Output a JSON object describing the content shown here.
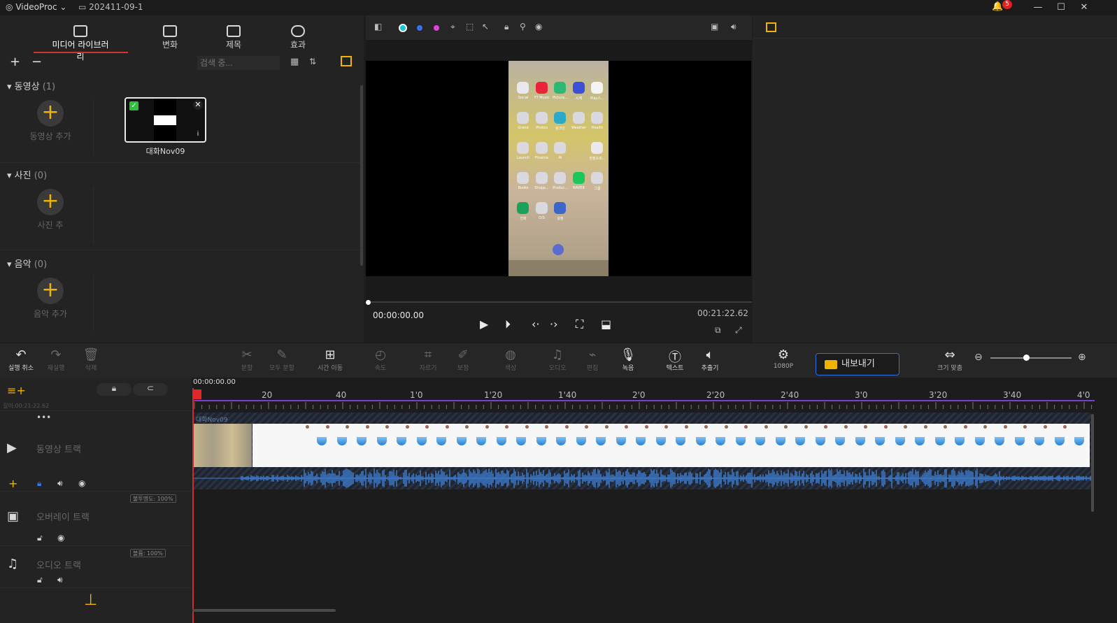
{
  "titlebar": {
    "app_name": "VideoProc",
    "project_name": "202411-09-1",
    "notification_count": "5",
    "minimize": "—",
    "maximize": "☐",
    "close": "✕"
  },
  "left_tabs": [
    {
      "label": "미디어 라이브러리",
      "icon": "media-library-icon"
    },
    {
      "label": "변화",
      "icon": "transition-icon"
    },
    {
      "label": "제목",
      "icon": "title-icon"
    },
    {
      "label": "효과",
      "icon": "effect-icon"
    }
  ],
  "library": {
    "search_placeholder": "검색 중...",
    "add": "+",
    "remove": "−",
    "sections": {
      "video": {
        "name": "동영상",
        "count": "(1)",
        "add_label": "동영상 추가"
      },
      "photo": {
        "name": "사진",
        "count": "(0)",
        "add_label": "사진 추"
      },
      "music": {
        "name": "음악",
        "count": "(0)",
        "add_label": "음악 추가"
      }
    },
    "clip_name": "대화Nov09"
  },
  "preview": {
    "current_time": "00:00:00.00",
    "total_time": "00:21:22.62",
    "phone_apps": [
      {
        "label": "Social",
        "color": "#e8e8ee"
      },
      {
        "label": "YT Music",
        "color": "#e8233a"
      },
      {
        "label": "Picture...",
        "color": "#2eb875"
      },
      {
        "label": "시계",
        "color": "#3a50d6"
      },
      {
        "label": "Play스...",
        "color": "#f4f4f4"
      },
      {
        "label": "Grand",
        "color": "#d9d9df"
      },
      {
        "label": "Photos",
        "color": "#d9d9df"
      },
      {
        "label": "링크인",
        "color": "#2aa9c9"
      },
      {
        "label": "Weather",
        "color": "#d9d9df"
      },
      {
        "label": "Health",
        "color": "#d9d9df"
      },
      {
        "label": "Launch",
        "color": "#d9d9df"
      },
      {
        "label": "Finance",
        "color": "#d9d9df"
      },
      {
        "label": "AI",
        "color": "#d9d9df"
      },
      {
        "label": "",
        "color": "transparent"
      },
      {
        "label": "한컴오피...",
        "color": "#e8e8ee"
      },
      {
        "label": "Books",
        "color": "#d9d9df"
      },
      {
        "label": "Shopp...",
        "color": "#d9d9df"
      },
      {
        "label": "Produc...",
        "color": "#d9d9df"
      },
      {
        "label": "NAVER",
        "color": "#19c75a"
      },
      {
        "label": "그룹",
        "color": "#d9d9df"
      },
      {
        "label": "전화",
        "color": "#1aa15a"
      },
      {
        "label": "O/S",
        "color": "#d9d9df"
      },
      {
        "label": "설정",
        "color": "#3d66c9"
      }
    ]
  },
  "toolbar": {
    "undo": "실행 취소",
    "redo": "재실행",
    "delete": "삭제",
    "split": "분할",
    "split_all": "모두 분할",
    "time_move": "시간 이동",
    "speed": "속도",
    "crop": "자르기",
    "correct": "보정",
    "color": "색상",
    "audio": "오디오",
    "edit": "편집",
    "record": "녹음",
    "text": "텍스트",
    "extract": "추출기",
    "resolution": "1080P",
    "export": "내보내기",
    "fit": "크기 맞춤"
  },
  "timeline": {
    "start_time": "00:00:00.00",
    "total_length": "길이:00:21:22.62",
    "ticks": [
      "20",
      "40",
      "1'0",
      "1'20",
      "1'40",
      "2'0",
      "2'20",
      "2'40",
      "3'0",
      "3'20",
      "3'40",
      "4'0"
    ],
    "tracks": {
      "video": "동영상 트랙",
      "overlay": "오버레이 트랙",
      "audio": "오디오 트랙"
    },
    "overlay_opacity": "불투명도: 100%",
    "audio_volume": "볼륨: 100%",
    "clip_label": "대화Nov09",
    "more": "•••"
  }
}
